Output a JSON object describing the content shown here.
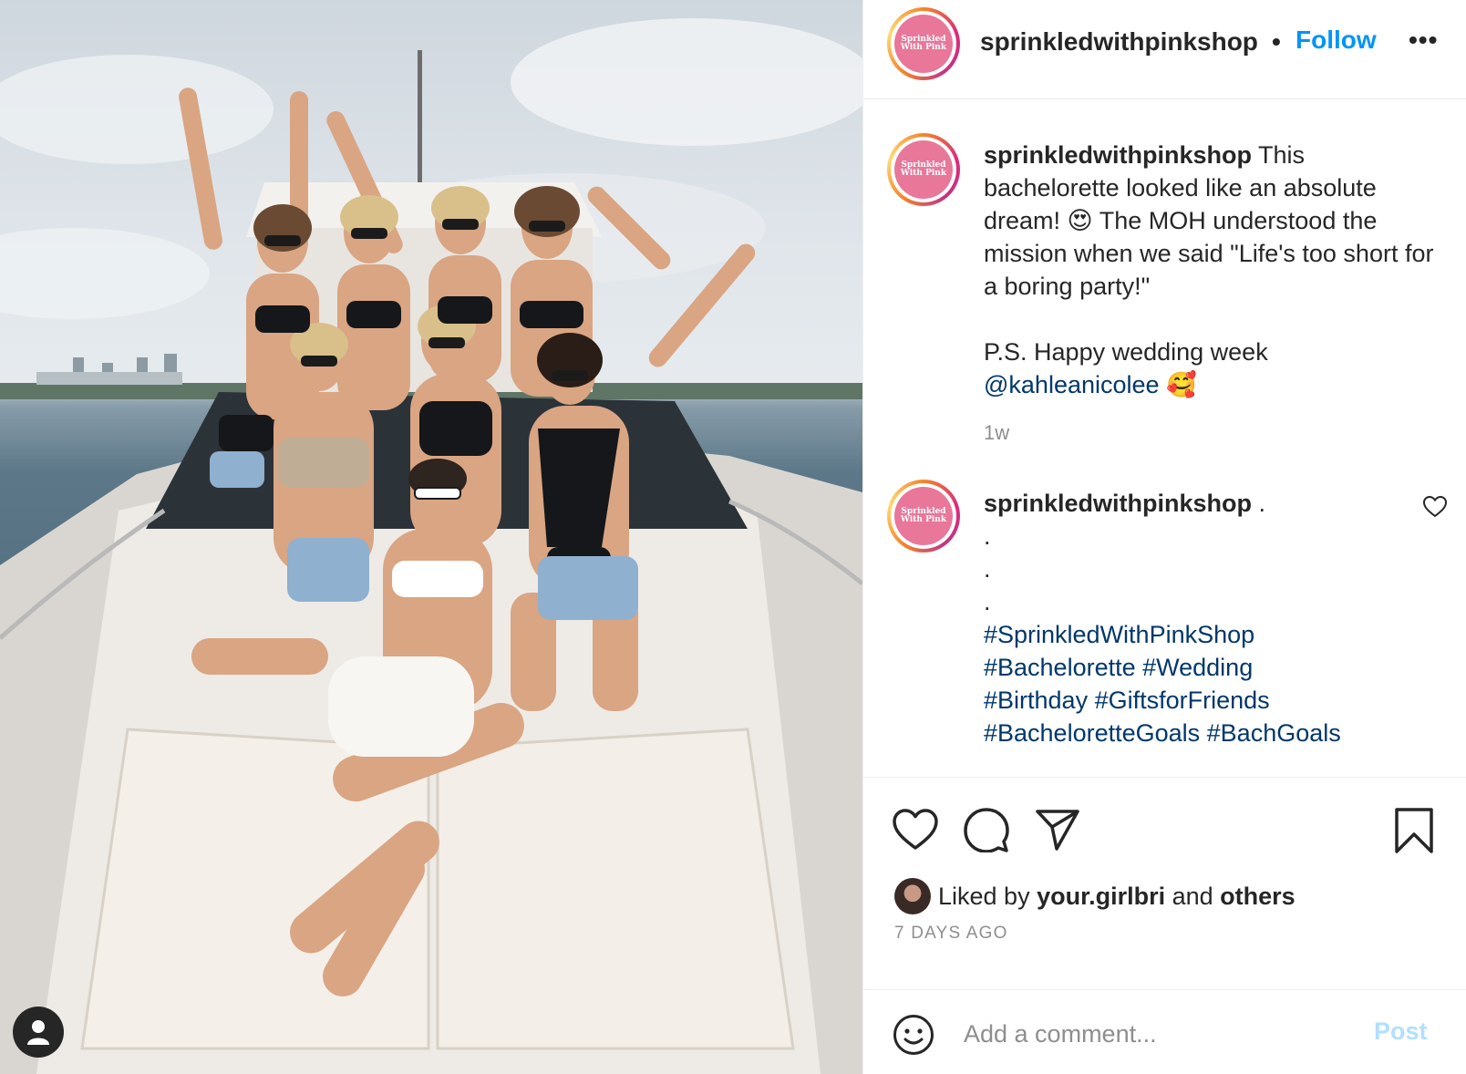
{
  "post": {
    "username": "sprinkledwithpinkshop",
    "avatar_lines": [
      "Sprinkled",
      "With Pink"
    ],
    "follow_label": "Follow",
    "separator": "•",
    "more_label": "•••"
  },
  "caption": {
    "username": "sprinkledwithpinkshop",
    "text_1": " This bachelorette looked like an absolute dream! ",
    "emoji_1": "😍",
    "text_2": " The MOH understood the mission when we said \"Life's too short for a boring party!\"",
    "text_3": "P.S. Happy wedding week",
    "mention": "@kahleanicolee",
    "emoji_2": "🥰",
    "time": "1w"
  },
  "comment": {
    "username": "sprinkledwithpinkshop",
    "first_line": " .",
    "dots": [
      ".",
      ".",
      "."
    ],
    "hashtags_line1": "#SprinkledWithPinkShop",
    "hashtags_line2": "#Bachelorette #Wedding",
    "hashtags_line3": "#Birthday #GiftsforFriends",
    "hashtags_line4": "#BacheloretteGoals #BachGoals"
  },
  "likes": {
    "prefix": "Liked by ",
    "liker": "your.girlbri",
    "middle": " and ",
    "others": "others",
    "date": "7 DAYS AGO"
  },
  "composer": {
    "placeholder": "Add a comment...",
    "post_label": "Post"
  },
  "icons": {
    "like": "heart-icon",
    "comment": "comment-bubble-icon",
    "share": "paper-plane-icon",
    "save": "bookmark-icon",
    "emoji": "smiley-icon",
    "tagged": "user-icon"
  },
  "colors": {
    "follow": "#0095f6",
    "link": "#00376b",
    "muted": "#8e8e8e",
    "post_disabled": "#b2dffc",
    "avatar_pink": "#e8779a"
  }
}
